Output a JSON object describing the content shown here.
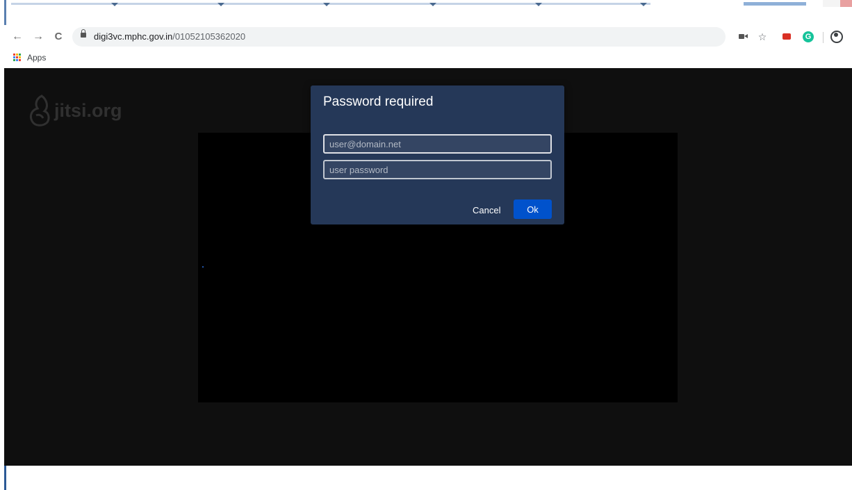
{
  "browser": {
    "url_host": "digi3vc.mphc.gov.in",
    "url_path": "/01052105362020",
    "back_icon": "←",
    "forward_icon": "→",
    "reload_icon": "C",
    "star_icon": "☆",
    "grammarly_letter": "G"
  },
  "bookmarks": {
    "apps_label": "Apps",
    "apps_colors": [
      "#ea4335",
      "#fbbc05",
      "#34a853",
      "#4285f4",
      "#ea4335",
      "#fbbc05",
      "#34a853",
      "#4285f4",
      "#ea4335"
    ]
  },
  "page": {
    "brand_text": "jitsi.org"
  },
  "dialog": {
    "title": "Password required",
    "user_placeholder": "user@domain.net",
    "password_placeholder": "user password",
    "cancel_label": "Cancel",
    "ok_label": "Ok"
  },
  "colors": {
    "dialog_bg": "#253858",
    "ok_button": "#0052cc",
    "page_bg": "#0f0f0f"
  }
}
